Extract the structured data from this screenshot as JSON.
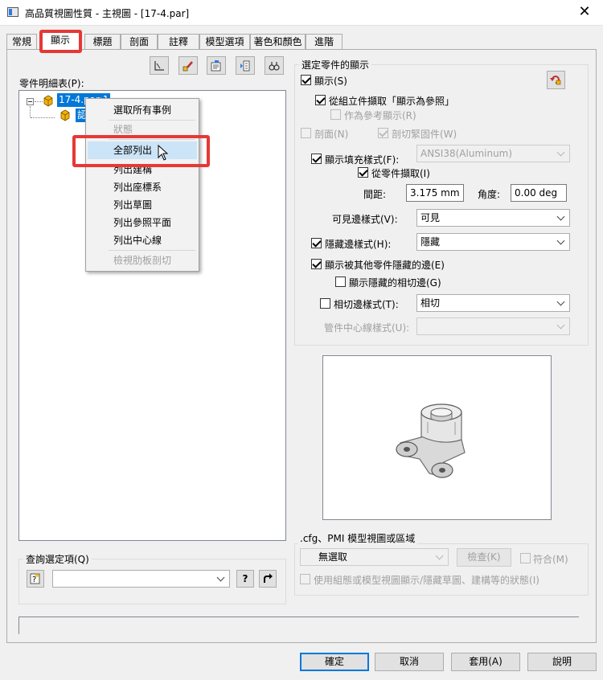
{
  "window": {
    "title": "高品質視圖性質 - 主視圖 - [17-4.par]",
    "close_glyph": "✕"
  },
  "tabs": [
    {
      "label": "常規"
    },
    {
      "label": "顯示"
    },
    {
      "label": "標題"
    },
    {
      "label": "剖面"
    },
    {
      "label": "註釋"
    },
    {
      "label": "模型選項"
    },
    {
      "label": "著色和顏色"
    },
    {
      "label": "進階"
    }
  ],
  "active_tab": "顯示",
  "left": {
    "parts_list_label": "零件明細表(P):",
    "tree": {
      "root": "17-4.par:1",
      "child": "認"
    },
    "context_menu": {
      "items": [
        {
          "label": "選取所有事例",
          "enabled": true
        },
        {
          "label": "狀態",
          "enabled": false
        },
        {
          "label": "全部列出",
          "enabled": true,
          "hover": true
        },
        {
          "label": "列出建構",
          "enabled": true
        },
        {
          "label": "列出座標系",
          "enabled": true
        },
        {
          "label": "列出草圖",
          "enabled": true
        },
        {
          "label": "列出參照平面",
          "enabled": true
        },
        {
          "label": "列出中心線",
          "enabled": true
        },
        {
          "label": "檢視肋板剖切",
          "enabled": false
        }
      ]
    },
    "query": {
      "group_label": "查詢選定項(Q)",
      "combo_value": "",
      "help_glyph": "?"
    }
  },
  "right": {
    "group_label": "選定零件的顯示",
    "show": {
      "label": "顯示(S)",
      "checked": true
    },
    "from_assembly": {
      "label": "從組立件擷取「顯示為參照」",
      "checked": true
    },
    "as_reference": {
      "label": "作為參考顯示(R)",
      "checked": false,
      "enabled": false
    },
    "section": {
      "label": "剖面(N)",
      "checked": false,
      "enabled": false
    },
    "cut_fasteners": {
      "label": "剖切緊固件(W)",
      "checked": true,
      "enabled": false
    },
    "fill_style": {
      "label": "顯示填充樣式(F):",
      "checked": true,
      "value": "ANSI38(Aluminum)"
    },
    "from_part": {
      "label": "從零件擷取(I)",
      "checked": true
    },
    "spacing": {
      "label": "間距:",
      "value": "3.175 mm"
    },
    "angle": {
      "label": "角度:",
      "value": "0.00 deg"
    },
    "visible_edge": {
      "label": "可見邊樣式(V):",
      "value": "可見"
    },
    "hidden_edge": {
      "label": "隱藏邊樣式(H):",
      "checked": true,
      "value": "隱藏"
    },
    "show_hidden_by_other": {
      "label": "顯示被其他零件隱藏的邊(E)",
      "checked": true
    },
    "show_hidden_tangent": {
      "label": "顯示隱藏的相切邊(G)",
      "checked": false
    },
    "tangent_edge": {
      "label": "相切邊樣式(T):",
      "checked": false,
      "value": "相切"
    },
    "tube_centerline": {
      "label": "管件中心線樣式(U):",
      "value": ""
    }
  },
  "cfg": {
    "group_label": ".cfg、PMI 模型視圖或區域",
    "combo_value": "無選取",
    "check_button": "檢查(K)",
    "match": {
      "label": "符合(M)",
      "checked": false
    },
    "use_config": {
      "label": "使用組態或模型視圖顯示/隱藏草圖、建構等的狀態(I)",
      "checked": false
    }
  },
  "buttons": {
    "ok": "確定",
    "cancel": "取消",
    "apply": "套用(A)",
    "help": "說明"
  },
  "colors": {
    "highlight": "#0078d7",
    "annotation_red": "#e53935"
  }
}
